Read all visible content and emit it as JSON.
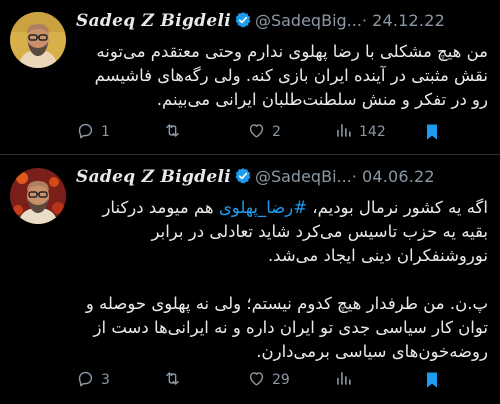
{
  "tweets": [
    {
      "author": {
        "name": "Sadeq Z Bigdeli",
        "handle": "@SadeqBig...",
        "verified": true
      },
      "separator": "·",
      "date": "24.12.22",
      "text_lines": [
        "من هیچ مشکلی با رضا پهلوی ندارم وحتی معتقدم می‌تونه",
        "نقش مثبتی در آینده ایران بازی کنه. ولی رگه‌های فاشیسم",
        "رو در تفکر و منش سلطنت‌طلبان ایرانی می‌بینم."
      ],
      "actions": {
        "replies": "1",
        "retweets": "",
        "likes": "2",
        "views": "142",
        "bookmarked": true
      }
    },
    {
      "author": {
        "name": "Sadeq Z Bigdeli",
        "handle": "@SadeqBi...",
        "verified": true
      },
      "separator": "·",
      "date": "04.06.22",
      "line1_before": "اگه یه کشور نرمال بودیم، ",
      "hashtag": "#رضا_پهلوی",
      "line1_after": " هم میومد درکنار",
      "text_lines": [
        "بقیه یه حزب تاسیس می‌کرد شاید تعادلی در برابر",
        "نوروشنفکران دینی ایجاد می‌شد."
      ],
      "text_lines_2": [
        "پ.ن. من طرفدار هیچ کدوم نیستم؛ ولی نه پهلوی حوصله و",
        "توان کار سیاسی جدی تو ایران داره و نه ایرانی‌ها دست از",
        "روضه‌خون‌های سیاسی برمی‌دارن."
      ],
      "actions": {
        "replies": "3",
        "retweets": "",
        "likes": "29",
        "views": "",
        "bookmarked": true
      }
    }
  ],
  "colors": {
    "background": "#000000",
    "text": "#e7e9ea",
    "muted": "#8b98a5",
    "accent": "#1d9bf0",
    "divider": "#2f3336"
  },
  "icons": [
    "verified-badge-icon",
    "reply-icon",
    "retweet-icon",
    "like-icon",
    "views-icon",
    "bookmark-icon"
  ]
}
